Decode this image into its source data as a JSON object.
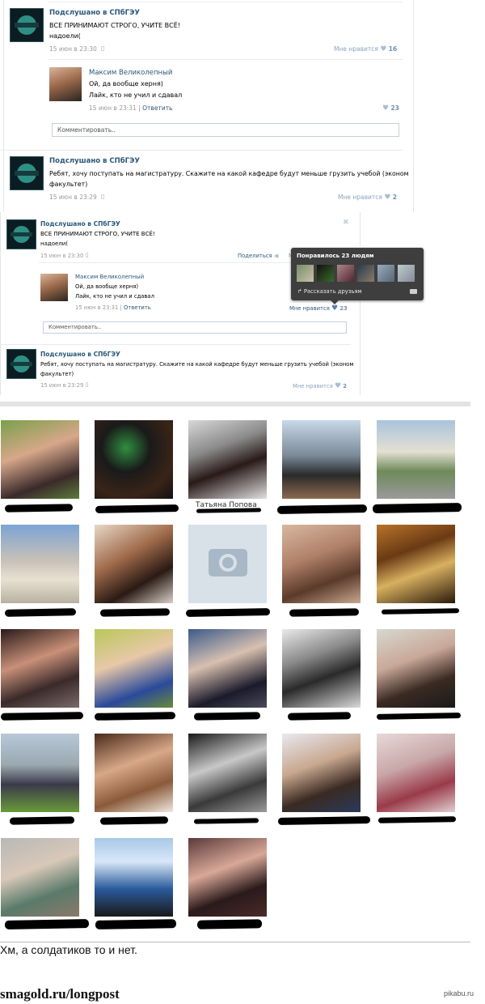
{
  "screenshot_a": {
    "post1": {
      "author": "Подслушано в СПбГЭУ",
      "text": "ВСЕ ПРИНИМАЮТ СТРОГО, УЧИТЕ ВСЁ!",
      "text2": "надоели(",
      "date": "15 июн в 23:30",
      "like_label": "Мне нравится",
      "like_count": "16"
    },
    "reply": {
      "author": "Максим Великолепный",
      "line1": "Ой, да вообще херня)",
      "line2": "Лайк, кто не учил и сдавал",
      "date": "15 июн в 23:31",
      "separator": "|",
      "reply_label": "Ответить",
      "like_count": "23"
    },
    "comment_placeholder": "Комментировать..",
    "post2": {
      "author": "Подслушано в СПбГЭУ",
      "text": "Ребят, хочу поступать на магистратуру. Скажите на какой кафедре будут меньше грузить учебой (эконом",
      "text2": "факультет)",
      "date": "15 июн в 23:29",
      "like_label": "Мне нравится",
      "like_count": "2"
    }
  },
  "screenshot_b": {
    "close_symbol": "✖",
    "post1": {
      "author": "Подслушано в СПбГЭУ",
      "text": "ВСЕ ПРИНИМАЮТ СТРОГО, УЧИТЕ ВСЁ!",
      "text2": "надоели(",
      "date": "15 июн в 23:30",
      "share_label": "Поделиться",
      "like_prefix": "М"
    },
    "popup": {
      "title": "Понравилось 23 людям",
      "share_label": "Рассказать друзьям"
    },
    "reply": {
      "author": "Максим Великолепный",
      "line1": "Ой, да вообще херня)",
      "line2": "Лайк, кто не учил и сдавал",
      "date": "15 июн в 23:31",
      "separator": "|",
      "reply_label": "Ответить",
      "like_label": "Мне нравится",
      "like_count": "23"
    },
    "comment_placeholder": "Комментировать..",
    "post2": {
      "author": "Подслушано в СПбГЭУ",
      "text": "Ребят, хочу поступать на магистратуру. Скажите на какой кафедре будут меньше грузить учебой (эконом",
      "text2": "факультет)",
      "date": "15 июн в 23:29",
      "like_label": "Мне нравится",
      "like_count": "2"
    }
  },
  "photo_grid": {
    "visible_names": [
      "Татьяна Попова"
    ],
    "placeholder_icon": "camera-icon"
  },
  "caption": "Хм, а солдатиков то и нет.",
  "footer": {
    "site": "smagold.ru/longpost",
    "watermark": "pikabu.ru"
  }
}
